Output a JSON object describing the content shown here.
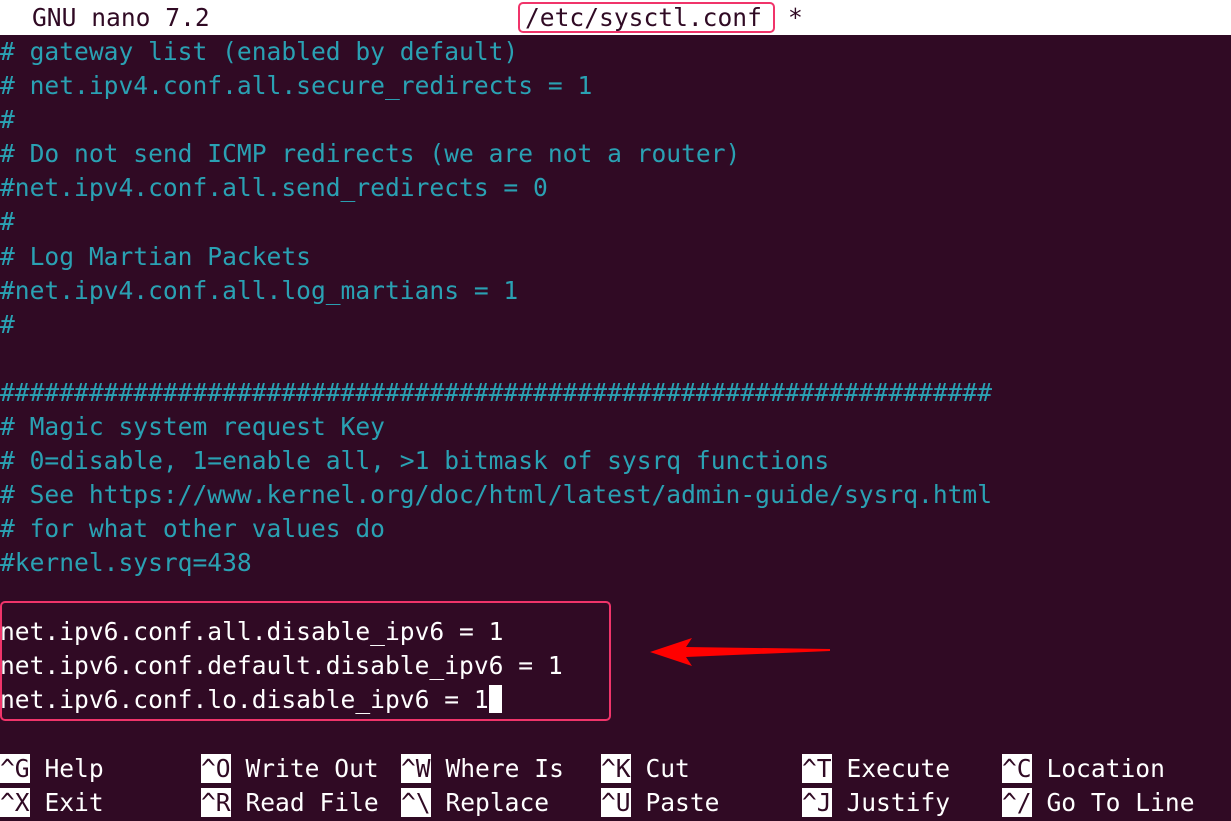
{
  "window": {
    "app_title": "GNU nano 7.2",
    "file_name": "/etc/sysctl.conf",
    "modified_marker": "*"
  },
  "colors": {
    "background": "#300a24",
    "comment_text": "#2aa1b3",
    "plain_text": "#ffffff",
    "highlight_border": "#f0346a",
    "arrow": "#ff0000"
  },
  "editor": {
    "lines": [
      {
        "text": "# gateway list (enabled by default)",
        "type": "comment"
      },
      {
        "text": "# net.ipv4.conf.all.secure_redirects = 1",
        "type": "comment"
      },
      {
        "text": "#",
        "type": "comment"
      },
      {
        "text": "# Do not send ICMP redirects (we are not a router)",
        "type": "comment"
      },
      {
        "text": "#net.ipv4.conf.all.send_redirects = 0",
        "type": "comment"
      },
      {
        "text": "#",
        "type": "comment"
      },
      {
        "text": "# Log Martian Packets",
        "type": "comment"
      },
      {
        "text": "#net.ipv4.conf.all.log_martians = 1",
        "type": "comment"
      },
      {
        "text": "#",
        "type": "comment"
      },
      {
        "text": "",
        "type": "blank"
      },
      {
        "text": "###################################################################",
        "type": "comment"
      },
      {
        "text": "# Magic system request Key",
        "type": "comment"
      },
      {
        "text": "# 0=disable, 1=enable all, >1 bitmask of sysrq functions",
        "type": "comment"
      },
      {
        "text": "# See https://www.kernel.org/doc/html/latest/admin-guide/sysrq.html",
        "type": "comment"
      },
      {
        "text": "# for what other values do",
        "type": "comment"
      },
      {
        "text": "#kernel.sysrq=438",
        "type": "comment"
      },
      {
        "text": "",
        "type": "blank"
      },
      {
        "text": "net.ipv6.conf.all.disable_ipv6 = 1",
        "type": "plain"
      },
      {
        "text": "net.ipv6.conf.default.disable_ipv6 = 1",
        "type": "plain"
      },
      {
        "text": "net.ipv6.conf.lo.disable_ipv6 = 1",
        "type": "plain"
      }
    ]
  },
  "shortcuts": [
    [
      {
        "key": "^G",
        "label": "Help"
      },
      {
        "key": "^O",
        "label": "Write Out"
      },
      {
        "key": "^W",
        "label": "Where Is"
      },
      {
        "key": "^K",
        "label": "Cut"
      },
      {
        "key": "^T",
        "label": "Execute"
      },
      {
        "key": "^C",
        "label": "Location"
      }
    ],
    [
      {
        "key": "^X",
        "label": "Exit"
      },
      {
        "key": "^R",
        "label": "Read File"
      },
      {
        "key": "^\\",
        "label": "Replace"
      },
      {
        "key": "^U",
        "label": "Paste"
      },
      {
        "key": "^J",
        "label": "Justify"
      },
      {
        "key": "^/",
        "label": "Go To Line"
      }
    ]
  ]
}
